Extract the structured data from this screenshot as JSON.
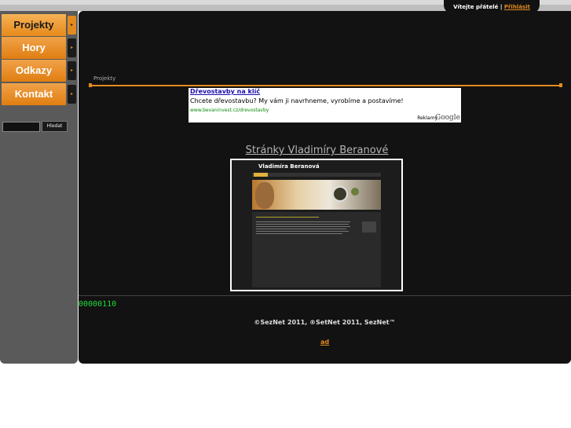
{
  "header": {
    "welcome_text": "Vítejte přátelé",
    "separator": "|",
    "login_link": "Přihlásit"
  },
  "sidebar": {
    "items": [
      {
        "label": "Projekty",
        "arrow": "▸"
      },
      {
        "label": "Hory",
        "arrow": "▸"
      },
      {
        "label": "Odkazy",
        "arrow": "▸"
      },
      {
        "label": "Kontakt",
        "arrow": "▸"
      }
    ],
    "search_button": "Hledat",
    "search_value": ""
  },
  "main": {
    "breadcrumb": "Projekty",
    "ad": {
      "title": "Dřevostavby na klíč",
      "text": "Chcete dřevostavbu? My vám ji navrhneme, vyrobíme a postavíme!",
      "url": "www.bevaninvest.cz/drevostavby",
      "reklamy": "Reklamy",
      "google": "Google"
    },
    "site_title": "Stránky Vladimíry Beranové",
    "thumbnail": {
      "title": "Vladimíra Beranová"
    },
    "counter": "00000110",
    "copyright": "©SezNet 2011, ®SetNet 2011, SezNet™",
    "ad_link": "ad"
  },
  "colors": {
    "accent": "#e38a1e",
    "sidebar_bg": "#5a5a5a",
    "main_bg": "#121212",
    "counter": "#1fdc3a"
  }
}
